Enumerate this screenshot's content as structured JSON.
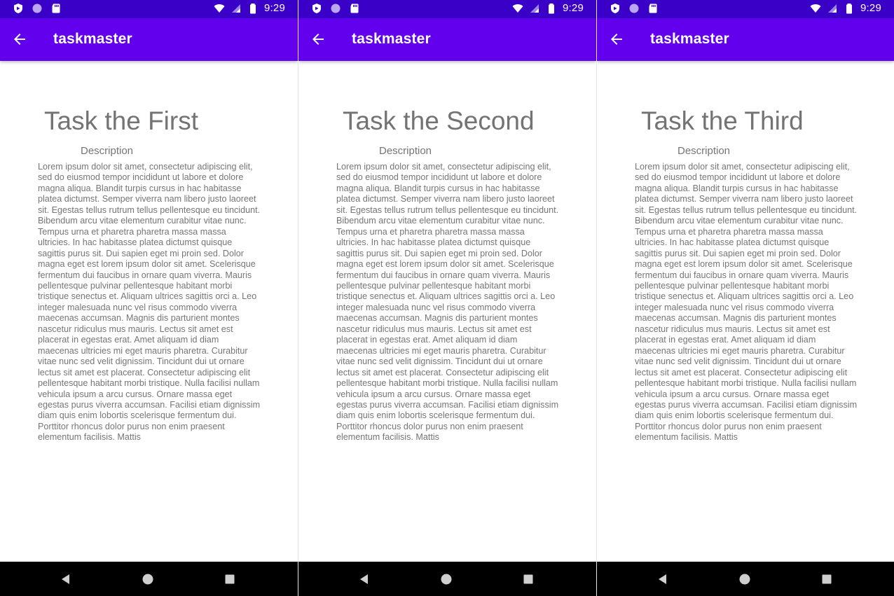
{
  "status_bar": {
    "time": "9:29"
  },
  "app_bar": {
    "title": "taskmaster"
  },
  "screens": [
    {
      "task_title": "Task the First",
      "description_label": "Description",
      "description_text": "Lorem ipsum dolor sit amet, consectetur adipiscing elit, sed do eiusmod tempor incididunt ut labore et dolore magna aliqua. Blandit turpis cursus in hac habitasse platea dictumst. Semper viverra nam libero justo laoreet sit. Egestas tellus rutrum tellus pellentesque eu tincidunt. Bibendum arcu vitae elementum curabitur vitae nunc. Tempus urna et pharetra pharetra massa massa ultricies. In hac habitasse platea dictumst quisque sagittis purus sit. Dui sapien eget mi proin sed. Dolor magna eget est lorem ipsum dolor sit amet. Scelerisque fermentum dui faucibus in ornare quam viverra. Mauris pellentesque pulvinar pellentesque habitant morbi tristique senectus et. Aliquam ultrices sagittis orci a.  Leo integer malesuada nunc vel risus commodo viverra maecenas accumsan. Magnis dis parturient montes nascetur ridiculus mus mauris. Lectus sit amet est placerat in egestas erat. Amet aliquam id diam maecenas ultricies mi eget mauris pharetra. Curabitur vitae nunc sed velit dignissim. Tincidunt dui ut ornare lectus sit amet est placerat. Consectetur adipiscing elit pellentesque habitant morbi tristique. Nulla facilisi nullam vehicula ipsum a arcu cursus. Ornare massa eget egestas purus viverra accumsan. Facilisi etiam dignissim diam quis enim lobortis scelerisque fermentum dui. Porttitor rhoncus dolor purus non enim praesent elementum facilisis. Mattis"
    },
    {
      "task_title": "Task the Second",
      "description_label": "Description",
      "description_text": "Lorem ipsum dolor sit amet, consectetur adipiscing elit, sed do eiusmod tempor incididunt ut labore et dolore magna aliqua. Blandit turpis cursus in hac habitasse platea dictumst. Semper viverra nam libero justo laoreet sit. Egestas tellus rutrum tellus pellentesque eu tincidunt. Bibendum arcu vitae elementum curabitur vitae nunc. Tempus urna et pharetra pharetra massa massa ultricies. In hac habitasse platea dictumst quisque sagittis purus sit. Dui sapien eget mi proin sed. Dolor magna eget est lorem ipsum dolor sit amet. Scelerisque fermentum dui faucibus in ornare quam viverra. Mauris pellentesque pulvinar pellentesque habitant morbi tristique senectus et. Aliquam ultrices sagittis orci a.  Leo integer malesuada nunc vel risus commodo viverra maecenas accumsan. Magnis dis parturient montes nascetur ridiculus mus mauris. Lectus sit amet est placerat in egestas erat. Amet aliquam id diam maecenas ultricies mi eget mauris pharetra. Curabitur vitae nunc sed velit dignissim. Tincidunt dui ut ornare lectus sit amet est placerat. Consectetur adipiscing elit pellentesque habitant morbi tristique. Nulla facilisi nullam vehicula ipsum a arcu cursus. Ornare massa eget egestas purus viverra accumsan. Facilisi etiam dignissim diam quis enim lobortis scelerisque fermentum dui. Porttitor rhoncus dolor purus non enim praesent elementum facilisis. Mattis"
    },
    {
      "task_title": "Task the Third",
      "description_label": "Description",
      "description_text": "Lorem ipsum dolor sit amet, consectetur adipiscing elit, sed do eiusmod tempor incididunt ut labore et dolore magna aliqua. Blandit turpis cursus in hac habitasse platea dictumst. Semper viverra nam libero justo laoreet sit. Egestas tellus rutrum tellus pellentesque eu tincidunt. Bibendum arcu vitae elementum curabitur vitae nunc. Tempus urna et pharetra pharetra massa massa ultricies. In hac habitasse platea dictumst quisque sagittis purus sit. Dui sapien eget mi proin sed. Dolor magna eget est lorem ipsum dolor sit amet. Scelerisque fermentum dui faucibus in ornare quam viverra. Mauris pellentesque pulvinar pellentesque habitant morbi tristique senectus et. Aliquam ultrices sagittis orci a.  Leo integer malesuada nunc vel risus commodo viverra maecenas accumsan. Magnis dis parturient montes nascetur ridiculus mus mauris. Lectus sit amet est placerat in egestas erat. Amet aliquam id diam maecenas ultricies mi eget mauris pharetra. Curabitur vitae nunc sed velit dignissim. Tincidunt dui ut ornare lectus sit amet est placerat. Consectetur adipiscing elit pellentesque habitant morbi tristique. Nulla facilisi nullam vehicula ipsum a arcu cursus. Ornare massa eget egestas purus viverra accumsan. Facilisi etiam dignissim diam quis enim lobortis scelerisque fermentum dui. Porttitor rhoncus dolor purus non enim praesent elementum facilisis. Mattis"
    }
  ],
  "icons": {
    "status_left": [
      "shield-icon",
      "circle-icon",
      "sd-card-icon"
    ],
    "status_right": [
      "wifi-icon",
      "signal-icon",
      "battery-icon"
    ],
    "app_bar": "arrow-back-icon",
    "nav": [
      "nav-back-icon",
      "nav-home-icon",
      "nav-recent-icon"
    ]
  },
  "colors": {
    "status_bar": "#3a00c8",
    "app_bar": "#6200ee",
    "title_text": "#737373",
    "body_text": "#757575",
    "nav_bar": "#000000"
  }
}
